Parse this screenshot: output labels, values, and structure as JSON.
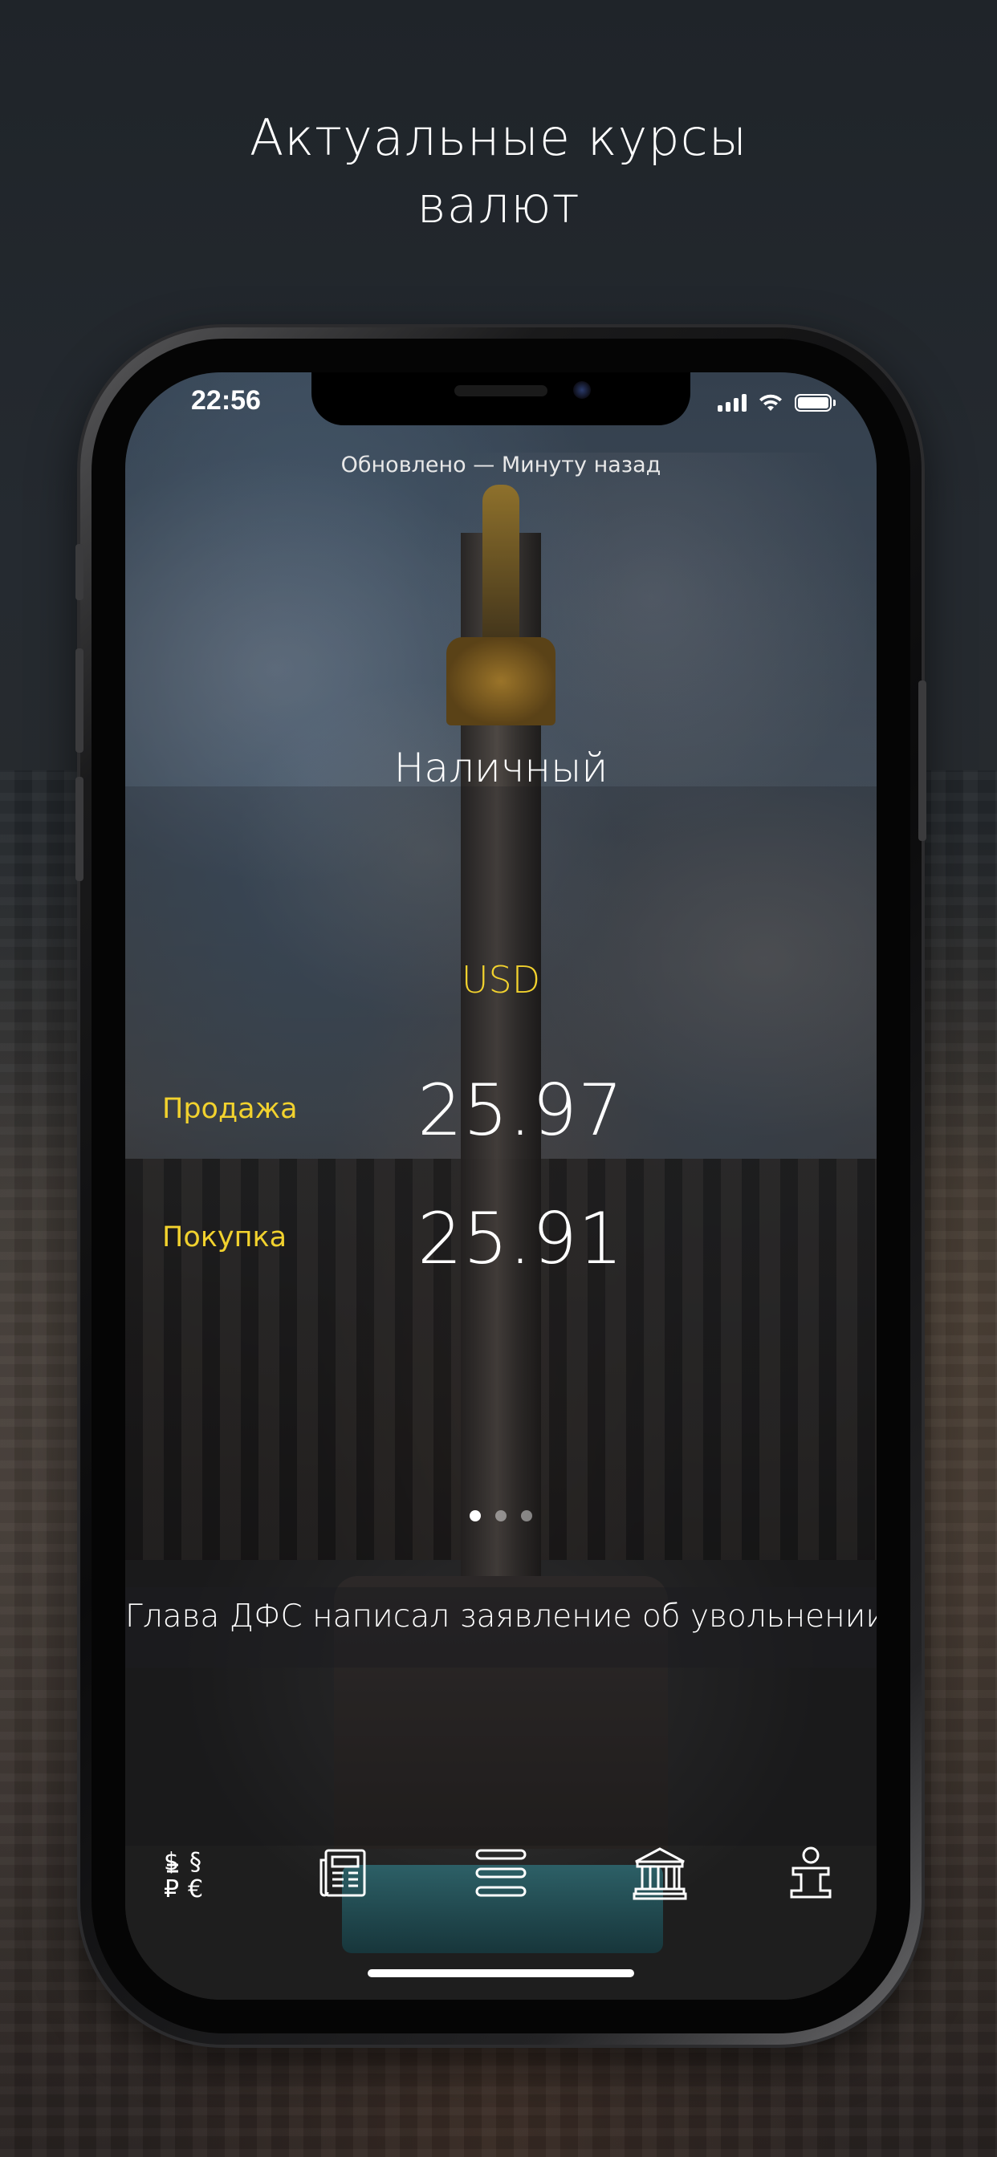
{
  "promo": {
    "headline_line1": "Актуальные курсы",
    "headline_line2": "валют"
  },
  "status_bar": {
    "time": "22:56",
    "icons": [
      "cellular-signal-icon",
      "wifi-icon",
      "battery-icon"
    ]
  },
  "header": {
    "updated_text": "Обновлено — Минуту назад"
  },
  "rates_page": {
    "title": "Наличный",
    "currency": "USD",
    "sell_label": "Продажа",
    "sell_value": "25.97",
    "buy_label": "Покупка",
    "buy_value": "25.91",
    "pager": {
      "total": 3,
      "current": 1
    }
  },
  "news": {
    "headline": "Глава ДФС написал заявление об увольнении"
  },
  "tabbar": {
    "items": [
      {
        "icon": "currency-exchange-icon"
      },
      {
        "icon": "newspaper-icon"
      },
      {
        "icon": "menu-icon"
      },
      {
        "icon": "bank-icon"
      },
      {
        "icon": "info-icon"
      }
    ]
  },
  "colors": {
    "accent_yellow": "#f2d22e",
    "text_white": "#ffffff"
  }
}
